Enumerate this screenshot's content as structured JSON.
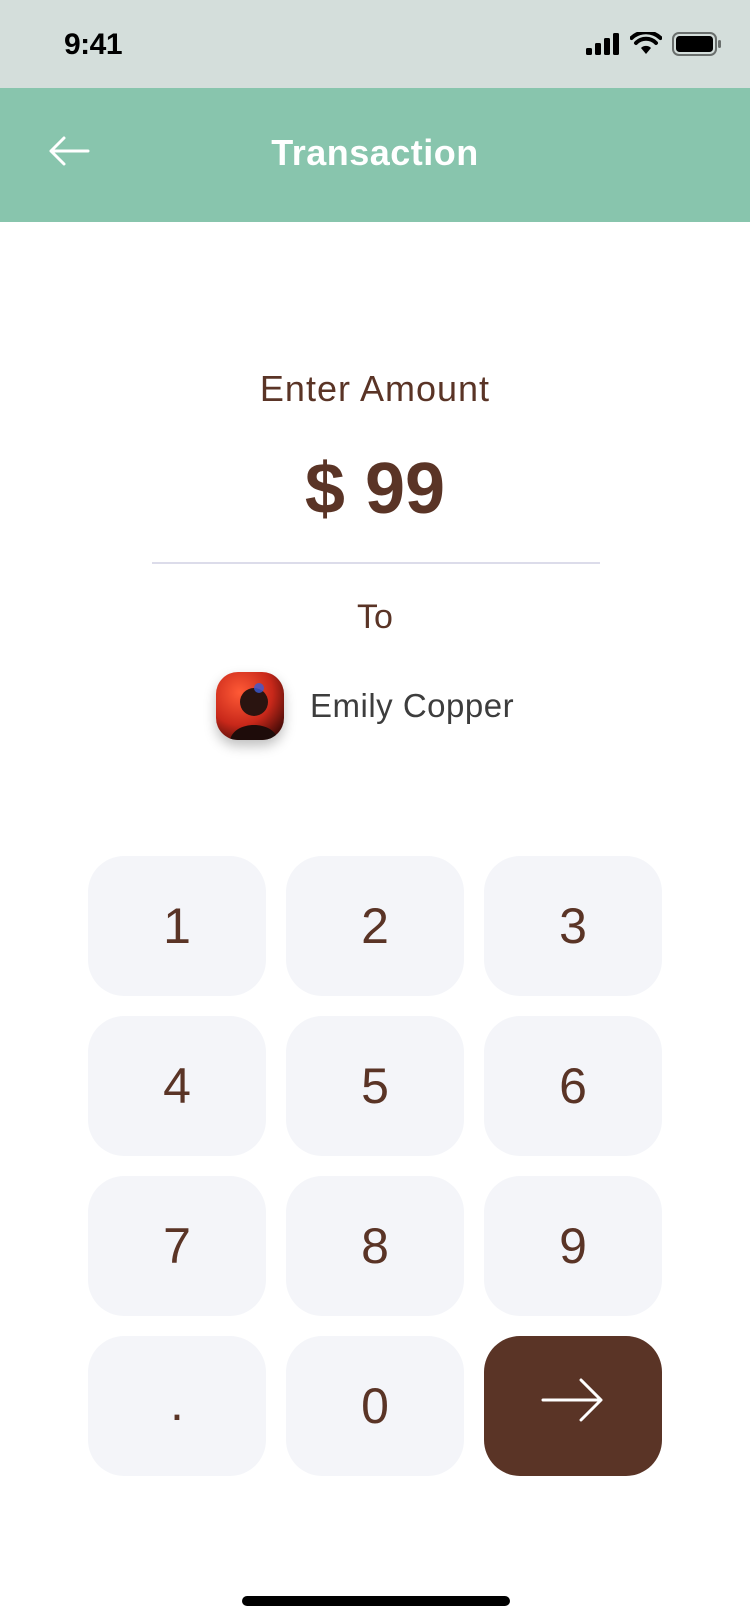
{
  "status_bar": {
    "time": "9:41"
  },
  "header": {
    "title": "Transaction"
  },
  "amount_section": {
    "label": "Enter Amount",
    "amount": "$ 99"
  },
  "recipient": {
    "to_label": "To",
    "name": "Emily Copper"
  },
  "keypad": {
    "keys": [
      "1",
      "2",
      "3",
      "4",
      "5",
      "6",
      "7",
      "8",
      "9",
      ".",
      "0"
    ]
  },
  "colors": {
    "accent": "#88c5ad",
    "brown": "#5a3426",
    "key_bg": "#f4f5f9",
    "status_bg": "#d4dedb"
  },
  "icons": {
    "back": "arrow-left-icon",
    "submit": "arrow-right-icon",
    "signal": "signal-icon",
    "wifi": "wifi-icon",
    "battery": "battery-icon"
  }
}
